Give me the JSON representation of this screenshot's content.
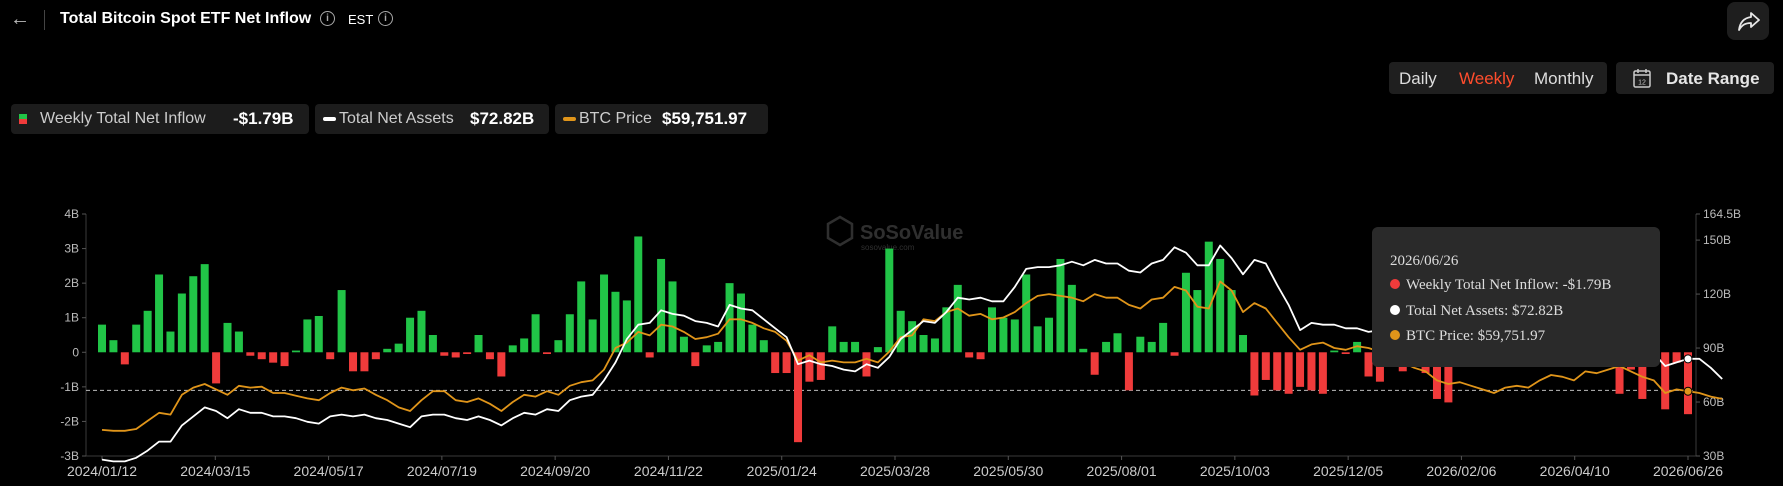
{
  "header": {
    "back_icon": "arrow-left-icon",
    "title": "Total Bitcoin Spot ETF Net Inflow",
    "timezone": "EST",
    "share_icon": "share-icon"
  },
  "controls": {
    "periods": [
      "Daily",
      "Weekly",
      "Monthly"
    ],
    "active_period": "Weekly",
    "date_range_label": "Date Range"
  },
  "legend": {
    "inflow_label": "Weekly Total Net Inflow",
    "inflow_value": "-$1.79B",
    "assets_label": "Total Net Assets",
    "assets_value": "$72.82B",
    "price_label": "BTC Price",
    "price_value": "$59,751.97"
  },
  "watermark": {
    "brand": "SoSoValue",
    "url": "sosovalue.com"
  },
  "tooltip": {
    "date": "2026/06/26",
    "inflow": "Weekly Total Net Inflow: -$1.79B",
    "assets": "Total Net Assets: $72.82B",
    "price": "BTC Price: $59,751.97"
  },
  "colors": {
    "positive": "#21c447",
    "negative": "#f03b3b",
    "assets_line": "#ffffff",
    "price_line": "#e0951a",
    "background": "#000000"
  },
  "chart_data": {
    "type": "bar",
    "left_axis": {
      "ticks": [
        "4B",
        "3B",
        "2B",
        "1B",
        "0",
        "-1B",
        "-2B",
        "-3B"
      ],
      "range_billion_usd": [
        -3,
        4
      ]
    },
    "right_axis": {
      "ticks": [
        "164.5B",
        "150B",
        "120B",
        "90B",
        "60B",
        "30B"
      ],
      "range_billion_usd": [
        30,
        164.5
      ]
    },
    "x_ticks": [
      "2024/01/12",
      "2024/03/15",
      "2024/05/17",
      "2024/07/19",
      "2024/09/20",
      "2024/11/22",
      "2025/01/24",
      "2025/03/28",
      "2025/05/30",
      "2025/08/01",
      "2025/10/03",
      "2025/12/05",
      "2026/02/06",
      "2026/04/10",
      "2026/06/26"
    ],
    "reference_line_billion_usd": -1.1,
    "series": [
      {
        "name": "Weekly Total Net Inflow",
        "unit": "billion USD",
        "values": [
          0.8,
          0.35,
          -0.35,
          0.8,
          1.2,
          2.25,
          0.6,
          1.7,
          2.2,
          2.55,
          -0.9,
          0.85,
          0.6,
          -0.1,
          -0.2,
          -0.3,
          -0.4,
          0.05,
          0.95,
          1.05,
          -0.2,
          1.8,
          -0.55,
          -0.55,
          -0.2,
          0.1,
          0.25,
          1.0,
          1.2,
          0.5,
          -0.1,
          -0.15,
          -0.05,
          0.5,
          -0.2,
          -0.7,
          0.2,
          0.4,
          1.1,
          -0.05,
          0.35,
          1.1,
          2.05,
          0.95,
          2.25,
          1.75,
          1.5,
          3.35,
          -0.15,
          2.7,
          2.05,
          0.45,
          -0.4,
          0.2,
          0.3,
          2.0,
          1.7,
          0.8,
          0.35,
          -0.6,
          -0.6,
          -2.6,
          -0.85,
          -0.8,
          0.75,
          0.3,
          0.3,
          -0.7,
          0.15,
          3.0,
          1.2,
          0.9,
          0.5,
          0.4,
          1.3,
          1.95,
          -0.15,
          -0.2,
          1.3,
          1.0,
          0.95,
          2.25,
          0.75,
          1.0,
          2.7,
          1.95,
          0.1,
          -0.65,
          0.3,
          0.55,
          -1.1,
          0.45,
          0.3,
          0.85,
          -0.1,
          2.3,
          1.8,
          3.2,
          2.7,
          1.8,
          0.5,
          -1.25,
          -0.8,
          -1.1,
          -1.2,
          -1.0,
          -1.1,
          -1.2,
          0.05,
          -0.05,
          0.3,
          -0.7,
          -0.85,
          -0.2,
          -0.55,
          0.15,
          -0.6,
          -1.35,
          -1.45,
          -0.35,
          -0.25,
          -0.4,
          0.3,
          -0.2,
          -0.3,
          -0.35,
          0.3,
          0.4,
          -0.15,
          -0.05,
          0.25,
          -0.3,
          0.05,
          -1.2,
          -0.5,
          -1.35,
          -0.15,
          -1.65,
          -0.3,
          -1.79
        ]
      },
      {
        "name": "Total Net Assets",
        "unit": "billion USD",
        "values": [
          28,
          27,
          27,
          29,
          33,
          38,
          38,
          47,
          52,
          57,
          55,
          51,
          56,
          54,
          54,
          52,
          52,
          51,
          49,
          48,
          52,
          53,
          52,
          53,
          51,
          50,
          48,
          46,
          52,
          53,
          53,
          51,
          50,
          52,
          50,
          47,
          51,
          54,
          53,
          56,
          55,
          61,
          63,
          64,
          72,
          82,
          95,
          103,
          104,
          111,
          109,
          108,
          105,
          104,
          102,
          114,
          112,
          111,
          106,
          101,
          96,
          81,
          83,
          81,
          80,
          78,
          77,
          81,
          79,
          85,
          95,
          100,
          105,
          104,
          110,
          118,
          117,
          118,
          116,
          116,
          124,
          134,
          135,
          135,
          136,
          138,
          136,
          139,
          137,
          137,
          133,
          132,
          137,
          139,
          146,
          143,
          136,
          136,
          147,
          140,
          131,
          139,
          137,
          125,
          114,
          100,
          104,
          103,
          103,
          101,
          101,
          99,
          100,
          96,
          96,
          96,
          95,
          90,
          92,
          95,
          92,
          90,
          90,
          91,
          91,
          95,
          95,
          92,
          91,
          89,
          91,
          90,
          90,
          92,
          90,
          87,
          87,
          80,
          82,
          84,
          84,
          79,
          72.82
        ]
      },
      {
        "name": "BTC Price",
        "unit": "USD",
        "values": [
          42500,
          42000,
          42000,
          43000,
          47500,
          52000,
          51000,
          62000,
          66000,
          68000,
          65000,
          62000,
          67000,
          66000,
          66500,
          63000,
          63000,
          61500,
          60000,
          59000,
          63000,
          66000,
          64500,
          65500,
          62000,
          59000,
          55000,
          53000,
          59000,
          64000,
          64000,
          59000,
          58000,
          60000,
          57000,
          53000,
          58000,
          62000,
          61000,
          64000,
          62000,
          67000,
          69000,
          70000,
          76000,
          88000,
          91000,
          97000,
          95000,
          101000,
          100000,
          97000,
          93000,
          94000,
          96000,
          104000,
          104000,
          102000,
          99000,
          97000,
          92000,
          81000,
          84000,
          80000,
          81000,
          80000,
          80000,
          82000,
          80000,
          86000,
          94000,
          95000,
          104000,
          103000,
          108000,
          110000,
          106000,
          107000,
          104000,
          105000,
          108000,
          113000,
          117000,
          118000,
          117000,
          116000,
          114000,
          118000,
          116000,
          116000,
          112000,
          110000,
          115000,
          116000,
          122000,
          120000,
          111000,
          110000,
          125000,
          120000,
          108000,
          113000,
          110000,
          102000,
          94000,
          87000,
          90000,
          91000,
          88000,
          87000,
          89000,
          88000,
          86000,
          84000,
          80000,
          77000,
          75000,
          70000,
          68000,
          69000,
          67000,
          65000,
          63000,
          66000,
          67000,
          66000,
          70000,
          73000,
          72000,
          70000,
          75000,
          74000,
          76000,
          78000,
          75000,
          72000,
          70000,
          63000,
          65000,
          64000,
          63000,
          61000,
          59751.97
        ]
      }
    ],
    "grid": false,
    "legend_position": "top-left"
  }
}
